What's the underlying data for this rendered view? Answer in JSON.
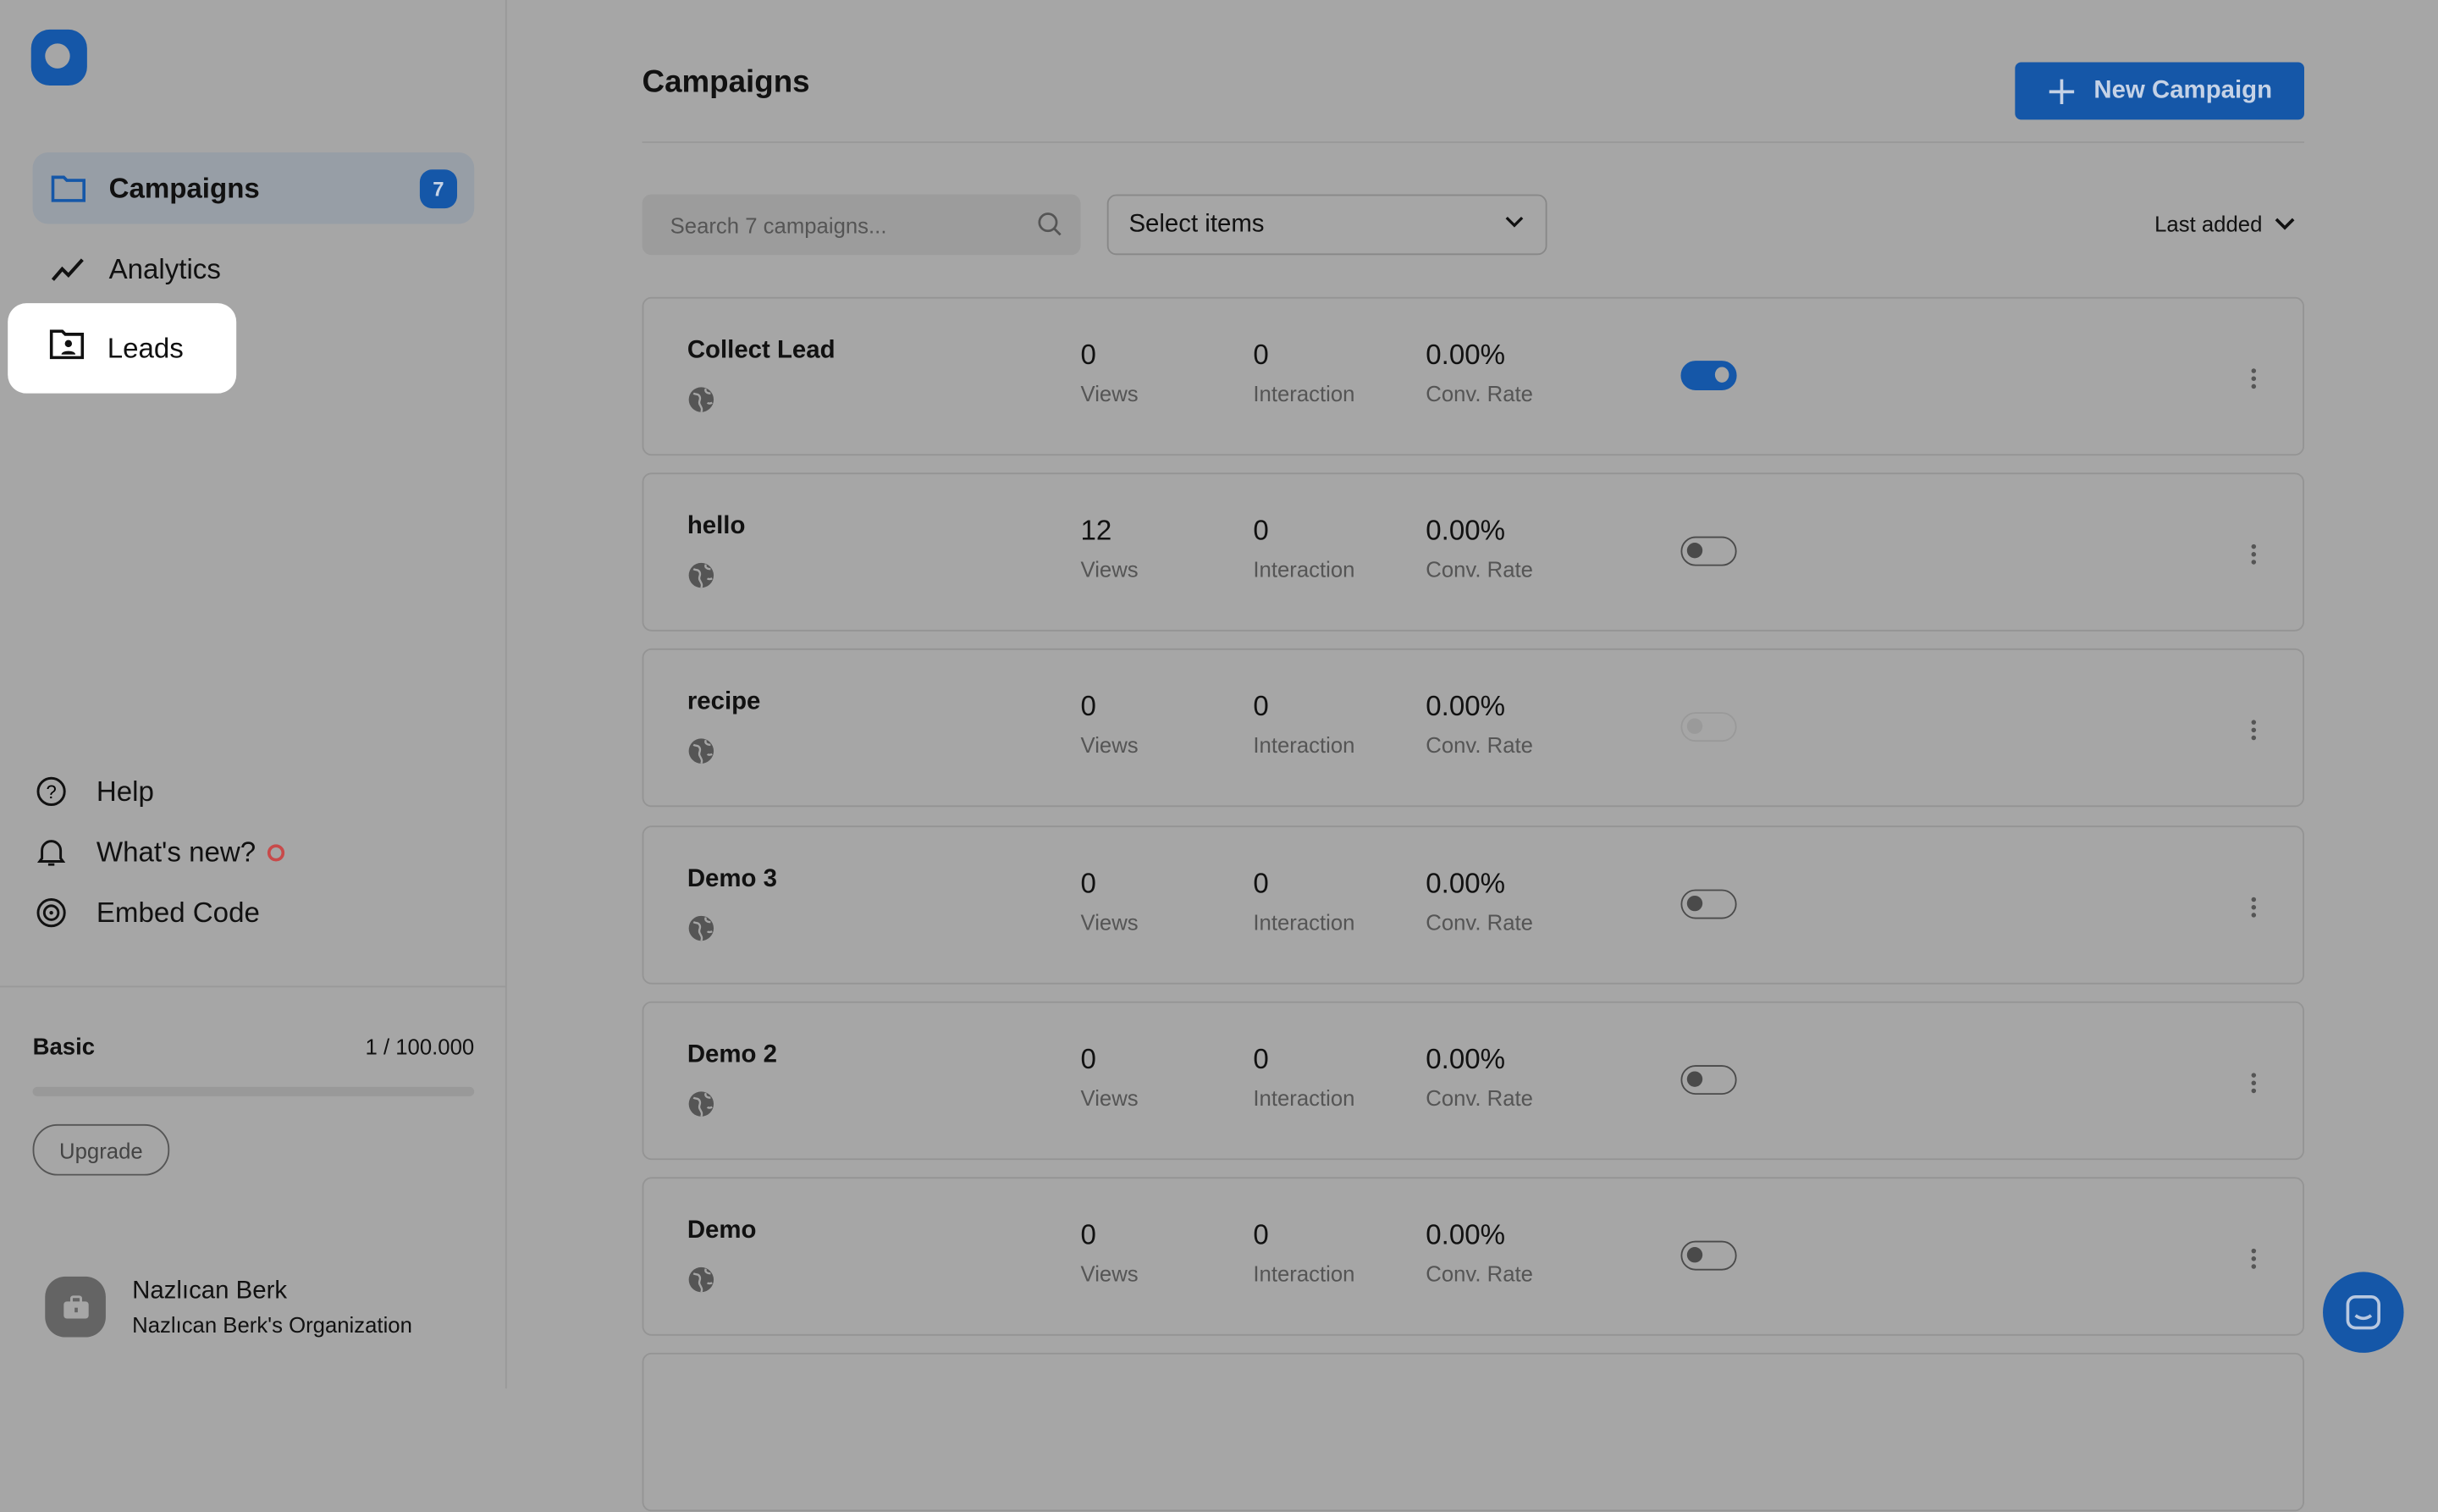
{
  "sidebar": {
    "nav": [
      {
        "label": "Campaigns",
        "badge": "7",
        "icon": "folder-icon",
        "active": true
      },
      {
        "label": "Analytics",
        "icon": "trend-icon"
      },
      {
        "label": "Leads",
        "icon": "folder-user-icon",
        "highlighted": true
      }
    ],
    "bottom": [
      {
        "label": "Help",
        "icon": "help-circle-icon"
      },
      {
        "label": "What's new?",
        "icon": "bell-icon"
      },
      {
        "label": "Embed Code",
        "icon": "embed-icon"
      }
    ],
    "plan": {
      "name": "Basic",
      "usage": "1 / 100.000",
      "usage_fraction": 1e-05,
      "upgrade_label": "Upgrade"
    },
    "user": {
      "name": "Nazlıcan Berk",
      "org": "Nazlıcan Berk's Organization"
    }
  },
  "main": {
    "title": "Campaigns",
    "new_button": "New Campaign",
    "search_placeholder": "Search 7 campaigns...",
    "select_label": "Select items",
    "sort_label": "Last added",
    "labels": {
      "views": "Views",
      "interaction": "Interaction",
      "conv": "Conv. Rate"
    },
    "campaigns": [
      {
        "name": "Collect Lead",
        "views": "0",
        "interaction": "0",
        "conv": "0.00%",
        "state": "on"
      },
      {
        "name": "hello",
        "views": "12",
        "interaction": "0",
        "conv": "0.00%",
        "state": "off"
      },
      {
        "name": "recipe",
        "views": "0",
        "interaction": "0",
        "conv": "0.00%",
        "state": "disabled"
      },
      {
        "name": "Demo 3",
        "views": "0",
        "interaction": "0",
        "conv": "0.00%",
        "state": "off"
      },
      {
        "name": "Demo 2",
        "views": "0",
        "interaction": "0",
        "conv": "0.00%",
        "state": "off"
      },
      {
        "name": "Demo",
        "views": "0",
        "interaction": "0",
        "conv": "0.00%",
        "state": "off"
      }
    ]
  },
  "colors": {
    "accent": "#1557a8",
    "overlay": "#a6a6a6"
  }
}
